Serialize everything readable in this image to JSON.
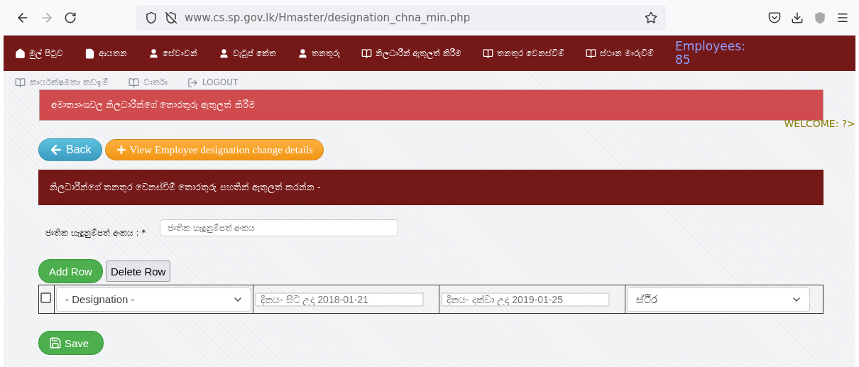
{
  "browser": {
    "url": "www.cs.sp.gov.lk/Hmaster/designation_chna_min.php"
  },
  "nav": {
    "items": [
      {
        "kind": "home",
        "label": "මුල් පිටුව"
      },
      {
        "kind": "file",
        "label": "ආයතන"
      },
      {
        "kind": "user",
        "label": "සේවාවන්"
      },
      {
        "kind": "user",
        "label": "වැටුප් කේත"
      },
      {
        "kind": "user",
        "label": "තනතුරු"
      },
      {
        "kind": "book",
        "label": "නිලධාරීන් ඇතුලත් කිරීම"
      },
      {
        "kind": "book",
        "label": "තනතුර වෙනස්වීම්"
      },
      {
        "kind": "book",
        "label": "ස්ථාන මාරුවීම්"
      }
    ],
    "employees": "Employees: 85",
    "sub_items": [
      {
        "kind": "book",
        "label": "කාර්යක්ෂමතා කඩඉම්"
      },
      {
        "kind": "book",
        "label": "වාර්තා"
      },
      {
        "kind": "logout",
        "label": "LOGOUT"
      }
    ]
  },
  "alert": "අමාත්‍යාංශවල නිලධාරීන්ගේ තොරතුරු ඇතුලත් කිරීම",
  "welcome": "WELCOME: ?>",
  "buttons": {
    "back": "Back",
    "view": "View Employee designation change details"
  },
  "section_title": "නිලධාරීන්ගේ තනතුර වෙනස්වීම් තොරතුරු පහතින් ඇතුලත් කරන්න -",
  "nic": {
    "label": "ජාතික හැඳුනුම්පත් අංකය : *",
    "placeholder": "ජාතික හැඳුනුම්පත් අංකය"
  },
  "row_buttons": {
    "add": "Add Row",
    "delete": "Delete Row"
  },
  "rows": [
    {
      "checked": false,
      "designation": "- Designation -",
      "from_placeholder": "දිනය- සිට උදා 2018-01-21",
      "to_placeholder": "දිනය- දක්වා උදා 2019-01-25",
      "status": "ස්ථිර"
    }
  ],
  "save": "Save"
}
